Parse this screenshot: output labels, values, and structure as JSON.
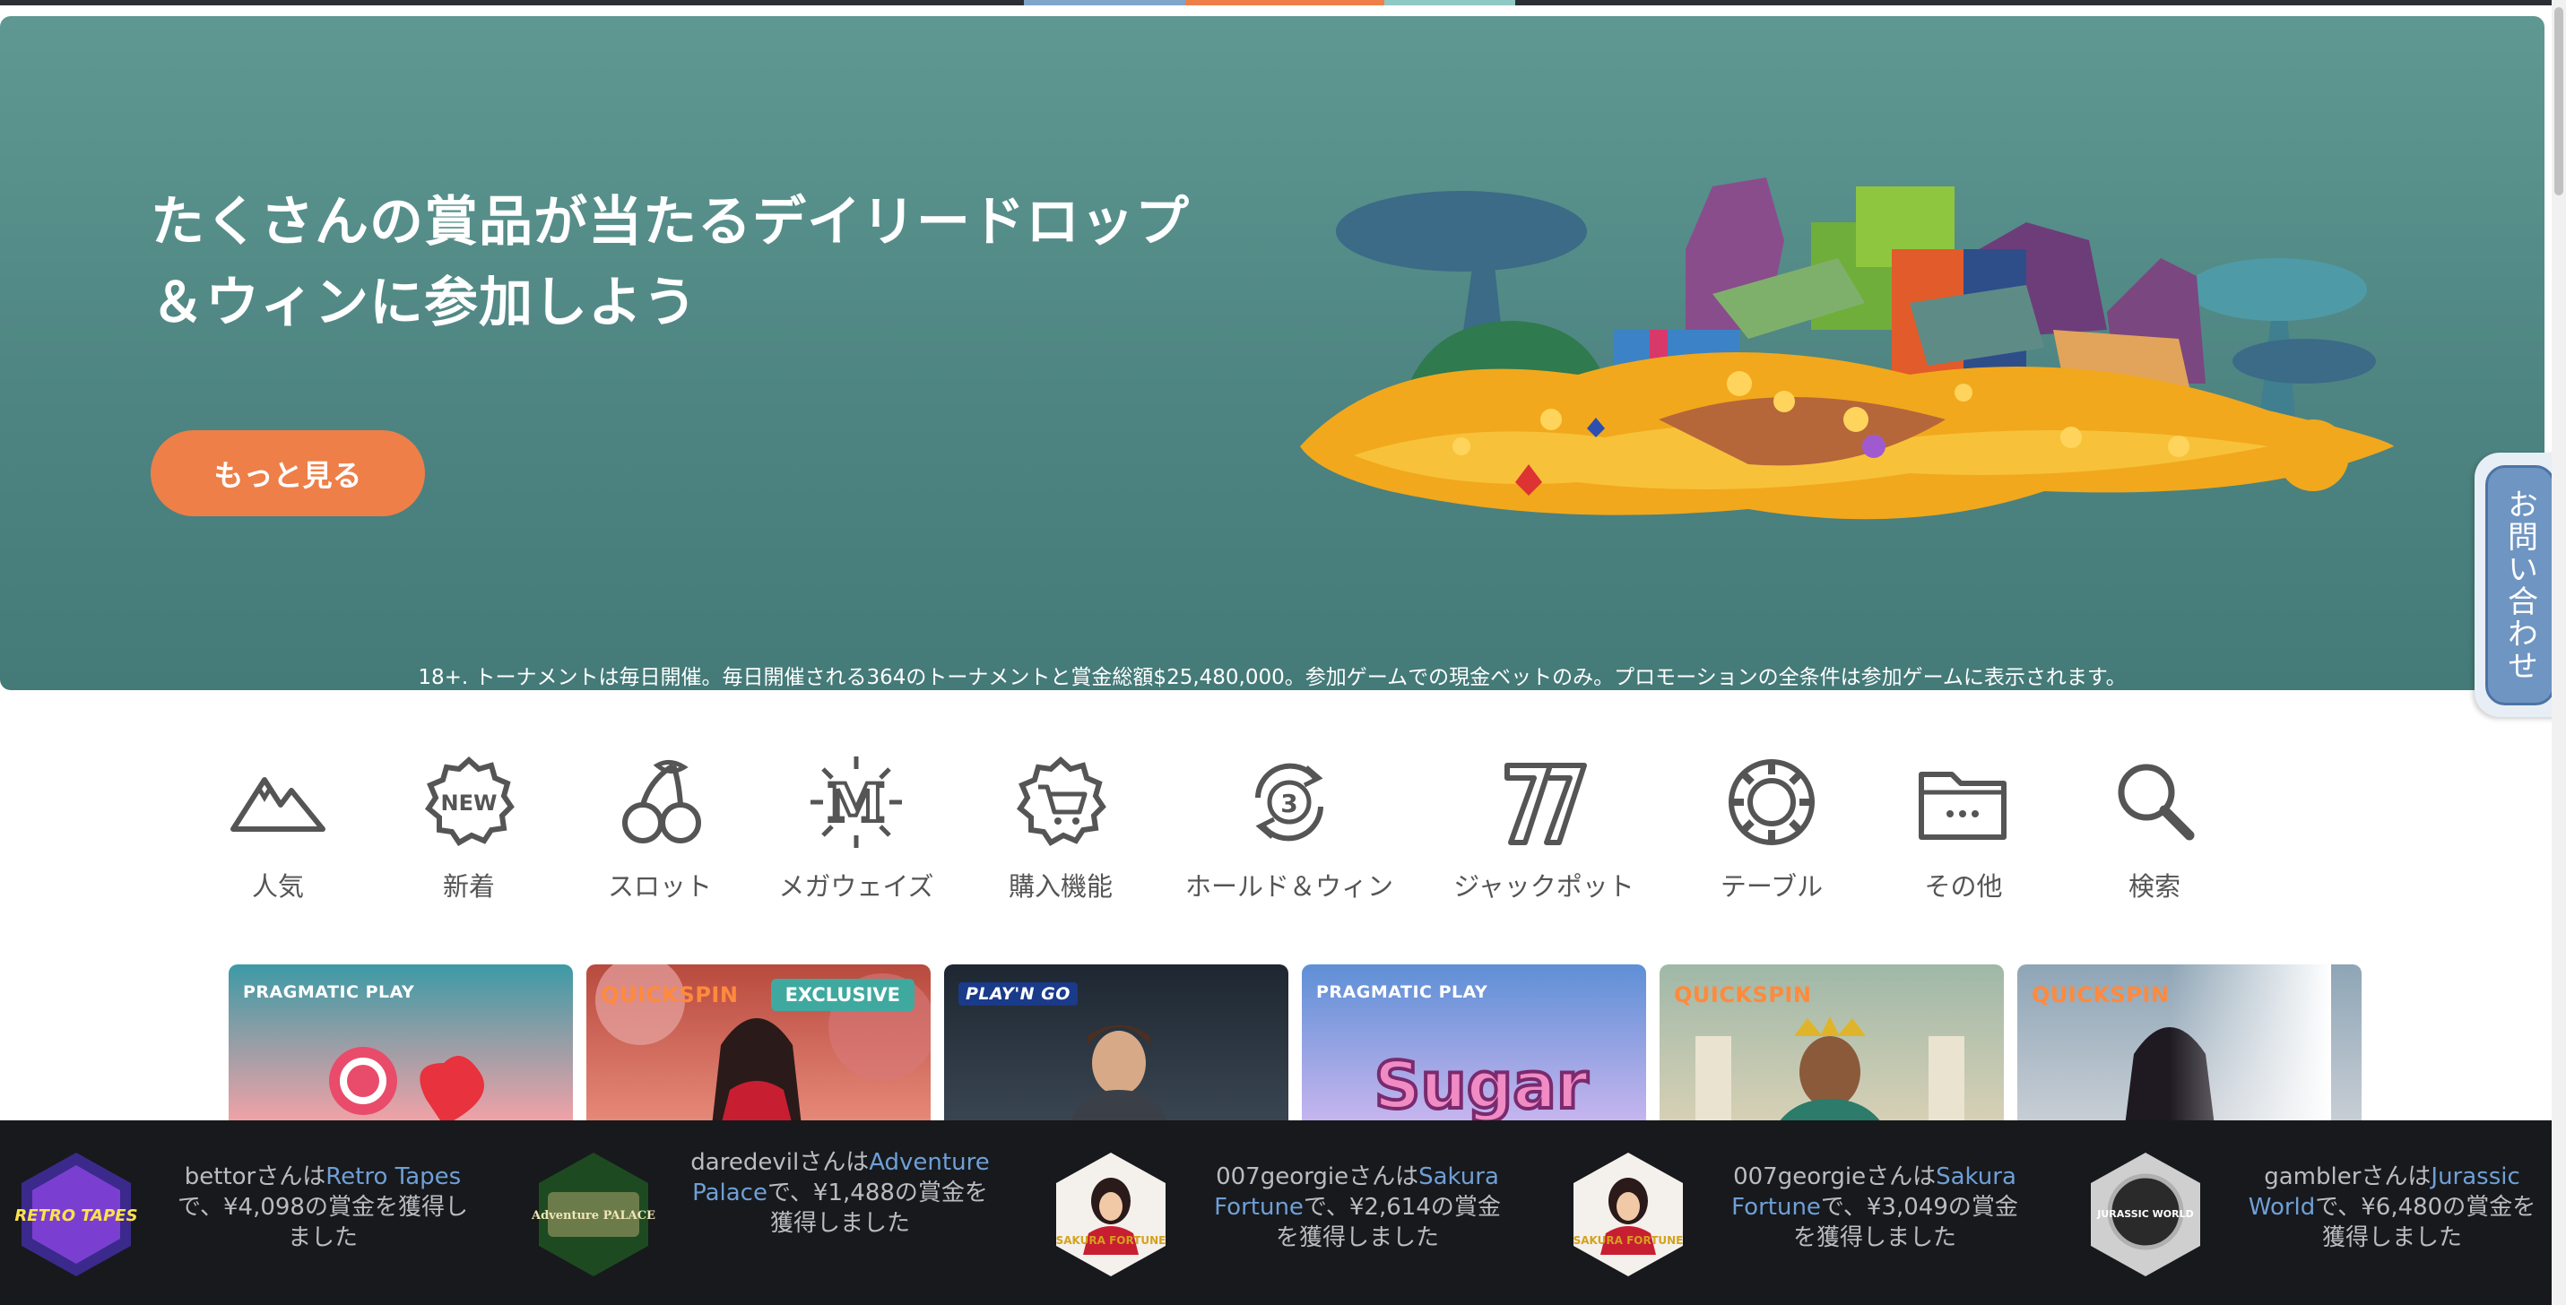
{
  "hero": {
    "title_line1": "たくさんの賞品が当たるデイリードロップ",
    "title_line2": "＆ウィンに参加しよう",
    "cta_label": "もっと見る",
    "disclaimer": "18+. トーナメントは毎日開催。毎日開催される364のトーナメントと賞金総額$25,480,000。参加ゲームでの現金ベットのみ。プロモーションの全条件は参加ゲームに表示されます。",
    "slide_progress": [
      1.0,
      1.0,
      0.13,
      0.0
    ]
  },
  "contact_tab": {
    "label": "お問い合わせ"
  },
  "categories": [
    {
      "label": "人気",
      "icon": "mountain-icon"
    },
    {
      "label": "新着",
      "icon": "new-badge-icon"
    },
    {
      "label": "スロット",
      "icon": "cherry-icon"
    },
    {
      "label": "メガウェイズ",
      "icon": "megaways-icon"
    },
    {
      "label": "購入機能",
      "icon": "cart-badge-icon"
    },
    {
      "label": "ホールド＆ウィン",
      "icon": "hold-win-icon"
    },
    {
      "label": "ジャックポット",
      "icon": "jackpot-seven-icon"
    },
    {
      "label": "テーブル",
      "icon": "chip-icon"
    },
    {
      "label": "その他",
      "icon": "folder-icon"
    },
    {
      "label": "検索",
      "icon": "search-icon"
    }
  ],
  "games": [
    {
      "provider": "PRAGMATIC PLAY",
      "badge": ""
    },
    {
      "provider": "QUICKSPIN",
      "badge": "EXCLUSIVE"
    },
    {
      "provider": "PLAY'N GO",
      "badge": ""
    },
    {
      "provider": "PRAGMATIC PLAY",
      "badge": "",
      "title": "Sugar"
    },
    {
      "provider": "QUICKSPIN",
      "badge": ""
    },
    {
      "provider": "QUICKSPIN",
      "badge": ""
    }
  ],
  "winners": [
    {
      "user": "bettor",
      "pre": "さんは",
      "game": "Retro Tapes",
      "post": "で、¥4,098の賞金を獲得しました",
      "thumb": "RETRO TAPES"
    },
    {
      "user": "daredevil",
      "pre": "さんは",
      "game": "Adventure Palace",
      "post": "で、¥1,488の賞金を獲得しました",
      "thumb": "Adventure PALACE"
    },
    {
      "user": "007georgie",
      "pre": "さんは",
      "game": "Sakura Fortune",
      "post": "で、¥2,614の賞金を獲得しました",
      "thumb": "SAKURA FORTUNE"
    },
    {
      "user": "007georgie",
      "pre": "さんは",
      "game": "Sakura Fortune",
      "post": "で、¥3,049の賞金を獲得しました",
      "thumb": "SAKURA FORTUNE"
    },
    {
      "user": "gambler",
      "pre": "さんは",
      "game": "Jurassic World",
      "post": "で、¥6,480の賞金を獲得しました",
      "thumb": "JURASSIC WORLD"
    }
  ],
  "colors": {
    "accent": "#ee7f48",
    "hero_bg": "#558d89",
    "ticker_bg": "#17191c",
    "link": "#6f9fd6"
  }
}
